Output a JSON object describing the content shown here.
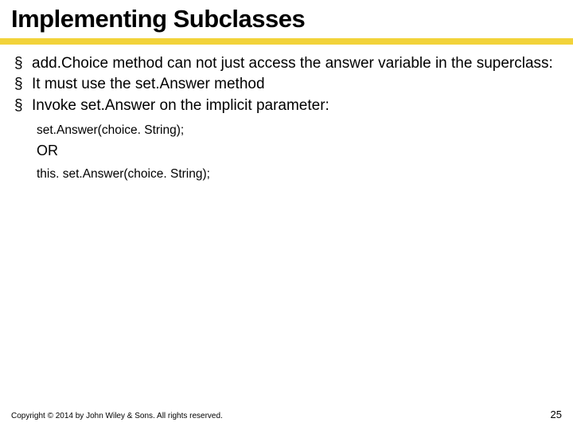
{
  "title": "Implementing Subclasses",
  "bullets": [
    "add.Choice method can not just access the answer variable in the superclass:",
    "It must use the set.Answer method",
    "Invoke set.Answer on the implicit parameter:"
  ],
  "code1": "set.Answer(choice. String);",
  "or_label": "OR",
  "code2": "this. set.Answer(choice. String);",
  "copyright": "Copyright © 2014 by John Wiley & Sons. All rights reserved.",
  "page_number": "25"
}
